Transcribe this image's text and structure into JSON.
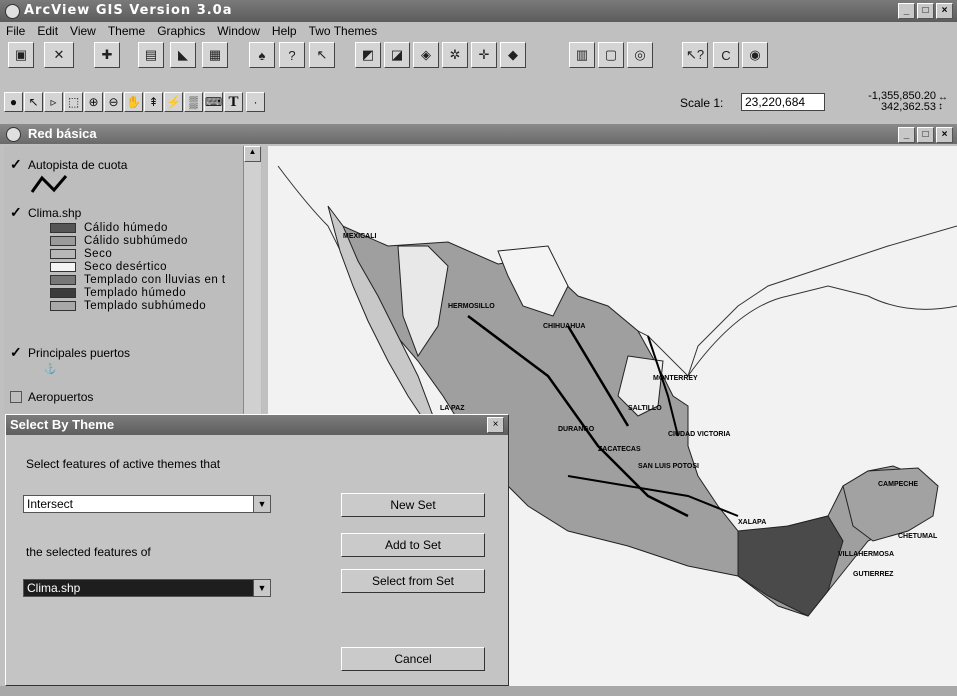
{
  "app": {
    "title": "ArcView GIS Version 3.0a",
    "window_buttons": [
      "_",
      "□",
      "×"
    ]
  },
  "menu": [
    "File",
    "Edit",
    "View",
    "Theme",
    "Graphics",
    "Window",
    "Help",
    "Two Themes"
  ],
  "toolbar": {
    "buttons": [
      "save-icon",
      "chart-icon",
      "add-theme-icon",
      "theme-props-icon",
      "edit-legend-icon",
      "table-icon",
      "find-icon",
      "help-query-icon",
      "select-icon",
      "zoom-extent-icon",
      "zoom-theme-icon",
      "zoom-selected-icon",
      "zoom-in-icon",
      "zoom-out-icon",
      "zoom-prev-icon",
      "layout-icon",
      "pan-icon",
      "locate-icon",
      "hotlink-icon",
      "c-icon",
      "target-icon"
    ]
  },
  "tools": {
    "buttons": [
      "info-tool",
      "pointer-tool",
      "vertex-tool",
      "select-feature-tool",
      "zoom-in-tool",
      "zoom-out-tool",
      "pan-tool",
      "measure-tool",
      "hotlink-tool",
      "area-tool",
      "label-tool",
      "text-tool",
      "draw-tool"
    ],
    "text_glyph": "T"
  },
  "scale": {
    "label": "Scale 1:",
    "value": "23,220,684",
    "x": "-1,355,850.20",
    "y": "342,362.53"
  },
  "view": {
    "title": "Red básica"
  },
  "toc": {
    "themes": [
      {
        "name": "Autopista de cuota",
        "checked": true
      },
      {
        "name": "Clima.shp",
        "checked": true
      },
      {
        "name": "Principales puertos",
        "checked": true
      },
      {
        "name": "Aeropuertos",
        "checked": false
      }
    ],
    "legend": [
      {
        "label": "Cálido húmedo",
        "color": "#555555"
      },
      {
        "label": "Cálido subhúmedo",
        "color": "#9a9a9a"
      },
      {
        "label": "Seco",
        "color": "#b8b8b8"
      },
      {
        "label": "Seco desértico",
        "color": "#f4f4f4"
      },
      {
        "label": "Templado con lluvias en t",
        "color": "#777777"
      },
      {
        "label": "Templado húmedo",
        "color": "#3c3c3c"
      },
      {
        "label": "Templado subhúmedo",
        "color": "#a8a8a8"
      }
    ]
  },
  "map": {
    "labels": [
      "MEXICALI",
      "HERMOSILLO",
      "CHIHUAHUA",
      "MONTERREY",
      "SALTILLO",
      "CIUDAD VICTORIA",
      "DURANGO",
      "ZACATECAS",
      "SAN LUIS POTOSI",
      "CAMPECHE",
      "CHETUMAL",
      "GUTIERREZ",
      "VILLAHERMOSA",
      "XALAPA",
      "LA PAZ"
    ]
  },
  "dialog": {
    "title": "Select By Theme",
    "prompt": "Select features of active themes that",
    "relation": "Intersect",
    "second_prompt": "the selected features of",
    "theme": "Clima.shp",
    "buttons": {
      "new_set": "New Set",
      "add_to_set": "Add to Set",
      "select_from_set": "Select from Set",
      "cancel": "Cancel"
    }
  }
}
